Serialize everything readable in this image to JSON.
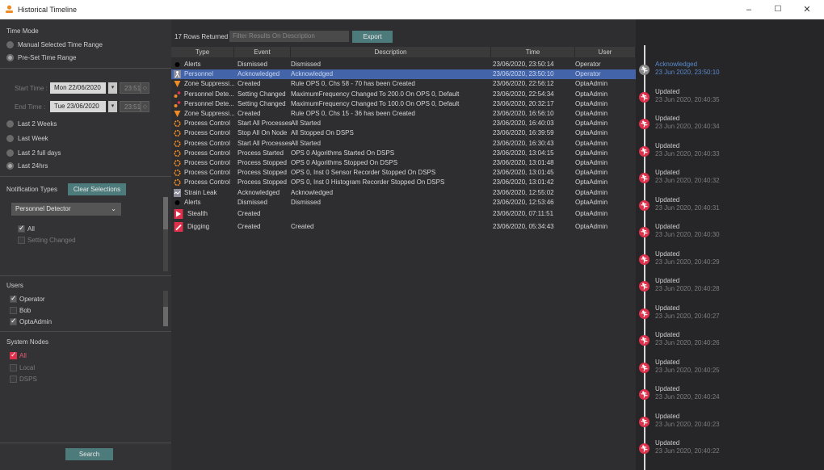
{
  "window": {
    "title": "Historical Timeline",
    "minimize": "–",
    "maximize": "☐",
    "close": "✕"
  },
  "filters": {
    "time_mode_label": "Time Mode",
    "manual_range_label": "Manual Selected Time Range",
    "preset_range_label": "Pre-Set Time Range",
    "start_label": "Start Time :",
    "start_date": "Mon 22/06/2020",
    "start_time": "23:51",
    "end_label": "End Time :",
    "end_date": "Tue 23/06/2020",
    "end_time": "23:51",
    "presets": [
      "Last 2 Weeks",
      "Last Week",
      "Last 2 full days",
      "Last 24hrs"
    ],
    "selected_preset": "Last 24hrs",
    "notification_types_label": "Notification Types",
    "clear_selections_label": "Clear Selections",
    "type_dropdown_value": "Personnel Detector",
    "type_all_label": "All",
    "setting_changed_label": "Setting Changed",
    "users_label": "Users",
    "users": [
      {
        "name": "Operator",
        "checked": true
      },
      {
        "name": "Bob",
        "checked": false
      },
      {
        "name": "OptaAdmin",
        "checked": true
      }
    ],
    "system_nodes_label": "System Nodes",
    "nodes": [
      {
        "name": "All",
        "checked": true
      },
      {
        "name": "Local",
        "checked": false
      },
      {
        "name": "DSPS",
        "checked": false
      }
    ],
    "search_label": "Search"
  },
  "table": {
    "rows_returned": "17 Rows Returned",
    "filter_placeholder": "Filter Results On Description",
    "export_label": "Export",
    "columns": [
      "Type",
      "Event",
      "Description",
      "Time",
      "User"
    ],
    "rows": [
      {
        "icon": "alert-dot-icon",
        "type": "Alerts",
        "event": "Dismissed",
        "description": "Dismissed",
        "time": "23/06/2020, 23:50:14",
        "user": "Operator"
      },
      {
        "icon": "personnel-icon",
        "type": "Personnel",
        "event": "Acknowledged",
        "description": "Acknowledged",
        "time": "23/06/2020, 23:50:10",
        "user": "Operator"
      },
      {
        "icon": "zone-suppression-icon",
        "type": "Zone Suppressi...",
        "event": "Created",
        "description": "Rule OPS 0, Chs 58 - 70 has been Created",
        "time": "23/06/2020, 22:56:12",
        "user": "OptaAdmin"
      },
      {
        "icon": "personnel-detector-icon",
        "type": "Personnel Dete...",
        "event": "Setting Changed",
        "description": "MaximumFrequency Changed To 200.0 On OPS 0, Default",
        "time": "23/06/2020, 22:54:34",
        "user": "OptaAdmin"
      },
      {
        "icon": "personnel-detector-icon",
        "type": "Personnel Dete...",
        "event": "Setting Changed",
        "description": "MaximumFrequency Changed To 100.0 On OPS 0, Default",
        "time": "23/06/2020, 20:32:17",
        "user": "OptaAdmin"
      },
      {
        "icon": "zone-suppression-icon",
        "type": "Zone Suppressi...",
        "event": "Created",
        "description": "Rule OPS 0, Chs 15 - 36 has been Created",
        "time": "23/06/2020, 16:56:10",
        "user": "OptaAdmin"
      },
      {
        "icon": "process-control-icon",
        "type": "Process Control",
        "event": "Start All Processes",
        "description": "All Started",
        "time": "23/06/2020, 16:40:03",
        "user": "OptaAdmin"
      },
      {
        "icon": "process-control-icon",
        "type": "Process Control",
        "event": "Stop All On Node",
        "description": "All Stopped On DSPS",
        "time": "23/06/2020, 16:39:59",
        "user": "OptaAdmin"
      },
      {
        "icon": "process-control-icon",
        "type": "Process Control",
        "event": "Start All Processes",
        "description": "All Started",
        "time": "23/06/2020, 16:30:43",
        "user": "OptaAdmin"
      },
      {
        "icon": "process-control-icon",
        "type": "Process Control",
        "event": "Process Started",
        "description": "OPS 0 Algorithms Started On DSPS",
        "time": "23/06/2020, 13:04:15",
        "user": "OptaAdmin"
      },
      {
        "icon": "process-control-icon",
        "type": "Process Control",
        "event": "Process Stopped",
        "description": "OPS 0 Algorithms Stopped On DSPS",
        "time": "23/06/2020, 13:01:48",
        "user": "OptaAdmin"
      },
      {
        "icon": "process-control-icon",
        "type": "Process Control",
        "event": "Process Stopped",
        "description": "OPS 0, Inst 0 Sensor Recorder Stopped On DSPS",
        "time": "23/06/2020, 13:01:45",
        "user": "OptaAdmin"
      },
      {
        "icon": "process-control-icon",
        "type": "Process Control",
        "event": "Process Stopped",
        "description": "OPS 0, Inst 0 Histogram Recorder Stopped On DSPS",
        "time": "23/06/2020, 13:01:42",
        "user": "OptaAdmin"
      },
      {
        "icon": "strain-leak-icon",
        "type": "Strain Leak",
        "event": "Acknowledged",
        "description": "Acknowledged",
        "time": "23/06/2020, 12:55:02",
        "user": "OptaAdmin"
      },
      {
        "icon": "alert-dot-icon",
        "type": "Alerts",
        "event": "Dismissed",
        "description": "Dismissed",
        "time": "23/06/2020, 12:53:46",
        "user": "OptaAdmin"
      },
      {
        "icon": "stealth-icon",
        "type": "Stealth",
        "event": "Created",
        "description": "",
        "time": "23/06/2020, 07:11:51",
        "user": "OptaAdmin"
      },
      {
        "icon": "digging-icon",
        "type": "Digging",
        "event": "Created",
        "description": "Created",
        "time": "23/06/2020, 05:34:43",
        "user": "OptaAdmin"
      }
    ],
    "selected_row": 1
  },
  "timeline": {
    "entries": [
      {
        "title": "Acknowledged",
        "time": "23 Jun 2020, 23:50:10",
        "active": true
      },
      {
        "title": "Updated",
        "time": "23 Jun 2020, 20:40:35"
      },
      {
        "title": "Updated",
        "time": "23 Jun 2020, 20:40:34"
      },
      {
        "title": "Updated",
        "time": "23 Jun 2020, 20:40:33"
      },
      {
        "title": "Updated",
        "time": "23 Jun 2020, 20:40:32"
      },
      {
        "title": "Updated",
        "time": "23 Jun 2020, 20:40:31"
      },
      {
        "title": "Updated",
        "time": "23 Jun 2020, 20:40:30"
      },
      {
        "title": "Updated",
        "time": "23 Jun 2020, 20:40:29"
      },
      {
        "title": "Updated",
        "time": "23 Jun 2020, 20:40:28"
      },
      {
        "title": "Updated",
        "time": "23 Jun 2020, 20:40:27"
      },
      {
        "title": "Updated",
        "time": "23 Jun 2020, 20:40:26"
      },
      {
        "title": "Updated",
        "time": "23 Jun 2020, 20:40:25"
      },
      {
        "title": "Updated",
        "time": "23 Jun 2020, 20:40:24"
      },
      {
        "title": "Updated",
        "time": "23 Jun 2020, 20:40:23"
      },
      {
        "title": "Updated",
        "time": "23 Jun 2020, 20:40:22"
      }
    ]
  },
  "colors": {
    "accent": "#4d7a7a",
    "selection": "#4364a8",
    "alert_red": "#e0314c",
    "active_text": "#5a8acc"
  }
}
